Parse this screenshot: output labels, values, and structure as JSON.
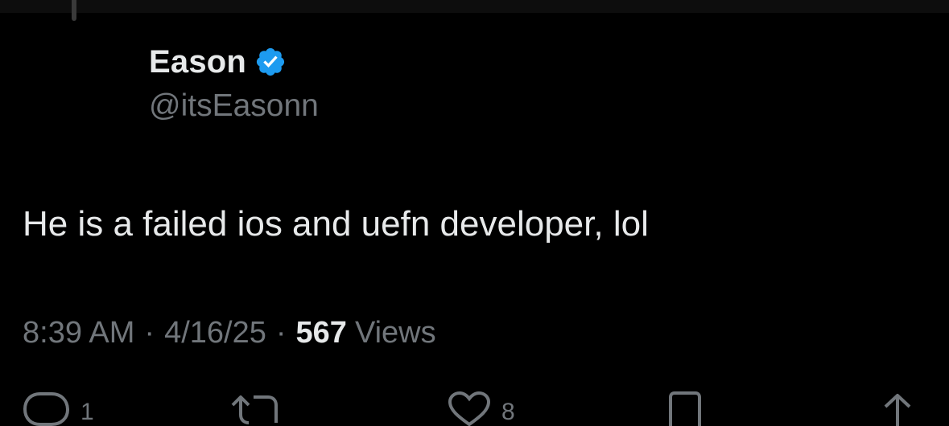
{
  "user": {
    "display_name": "Eason",
    "handle": "@itsEasonn",
    "verified_icon": "verified-badge-icon",
    "verified_color": "#1d9bf0"
  },
  "post": {
    "text": "He is a failed ios and uefn developer, lol",
    "time": "8:39 AM",
    "separator": "·",
    "date": "4/16/25",
    "views_count": "567",
    "views_label": "Views"
  },
  "actions": {
    "reply": {
      "icon": "reply-icon",
      "count": "1"
    },
    "repost": {
      "icon": "repost-icon"
    },
    "like": {
      "icon": "heart-icon",
      "count": "8"
    },
    "bookmark": {
      "icon": "bookmark-icon"
    },
    "share": {
      "icon": "share-icon"
    }
  },
  "colors": {
    "background": "#000000",
    "primary_text": "#e7e9ea",
    "secondary_text": "#71767b"
  }
}
